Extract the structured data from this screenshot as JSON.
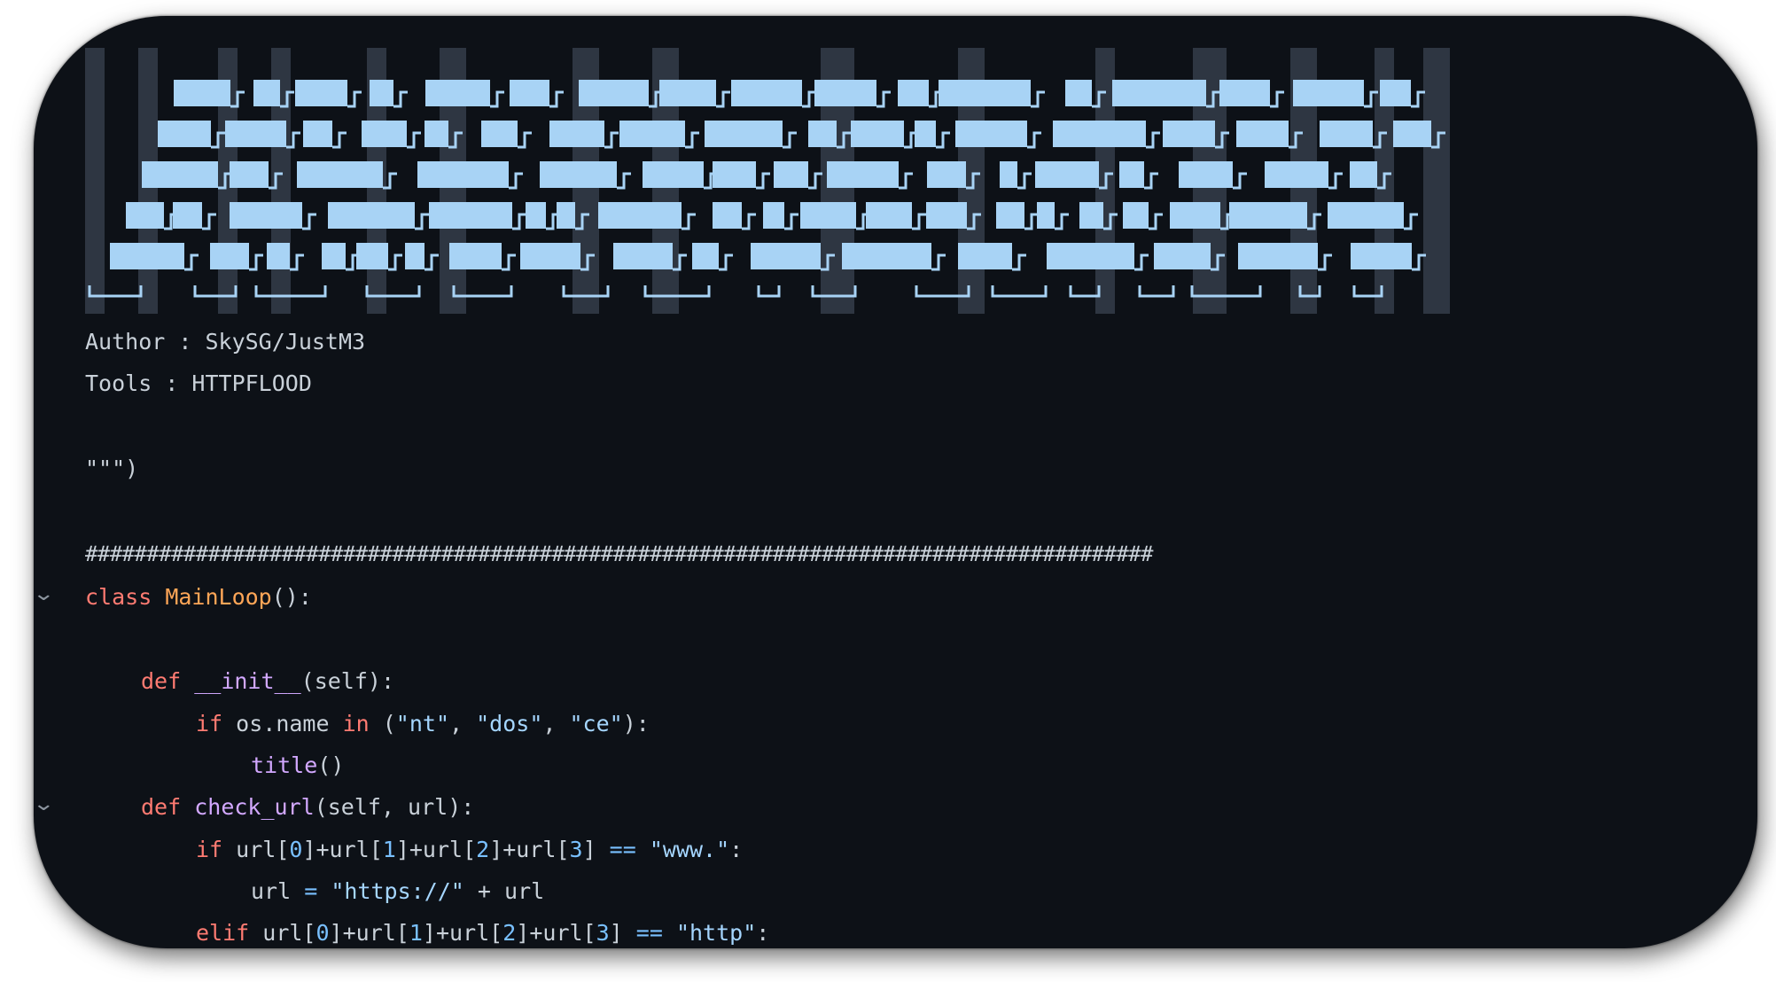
{
  "code": {
    "author_line": "Author : SkySG/JustM3",
    "tools_line": "Tools : HTTPFLOOD",
    "closing_quote": "\"\"\")",
    "separator": "#######################################################################################",
    "class_line": {
      "keyword": "class",
      "name": "MainLoop",
      "rest": "():"
    },
    "init_line": {
      "keyword": "def",
      "name": "__init__",
      "rest": "(self):"
    },
    "if_os_line": {
      "keyword": "if",
      "part1": " os.name ",
      "in_kw": "in",
      "part2": " (",
      "s1": "\"nt\"",
      "comma1": ", ",
      "s2": "\"dos\"",
      "comma2": ", ",
      "s3": "\"ce\"",
      "end": "):"
    },
    "title_line": {
      "name": "title",
      "rest": "()"
    },
    "check_url_line": {
      "keyword": "def",
      "name": "check_url",
      "rest": "(self, url):"
    },
    "if_www_line": {
      "keyword": "if",
      "a1": " url[",
      "n0": "0",
      "a2": "]+url[",
      "n1": "1",
      "a3": "]+url[",
      "n2": "2",
      "a4": "]+url[",
      "n3": "3",
      "a5": "] ",
      "eq": "==",
      "sp": " ",
      "str": "\"www.\"",
      "end": ":"
    },
    "url_assign_line": {
      "lhs": "url ",
      "eq": "=",
      "sp": " ",
      "str": "\"https://\"",
      "rhs": " + url"
    },
    "elif_line": {
      "keyword": "elif",
      "a1": " url[",
      "n0": "0",
      "a2": "]+url[",
      "n1": "1",
      "a3": "]+url[",
      "n2": "2",
      "a4": "]+url[",
      "n3": "3",
      "a5": "] ",
      "eq": "==",
      "sp": " ",
      "str": "\"http\"",
      "end": ":"
    }
  },
  "icons": {
    "fold_class": "chevron-down-icon",
    "fold_def": "chevron-down-icon"
  },
  "colors": {
    "background": "#0d1117",
    "text": "#c9d1d9",
    "keyword": "#ff7b72",
    "class_name": "#ffa657",
    "function_name": "#d2a8ff",
    "string": "#a5d6ff",
    "ascii_fill": "#a8d3f5",
    "ascii_shade": "#4a5566"
  }
}
